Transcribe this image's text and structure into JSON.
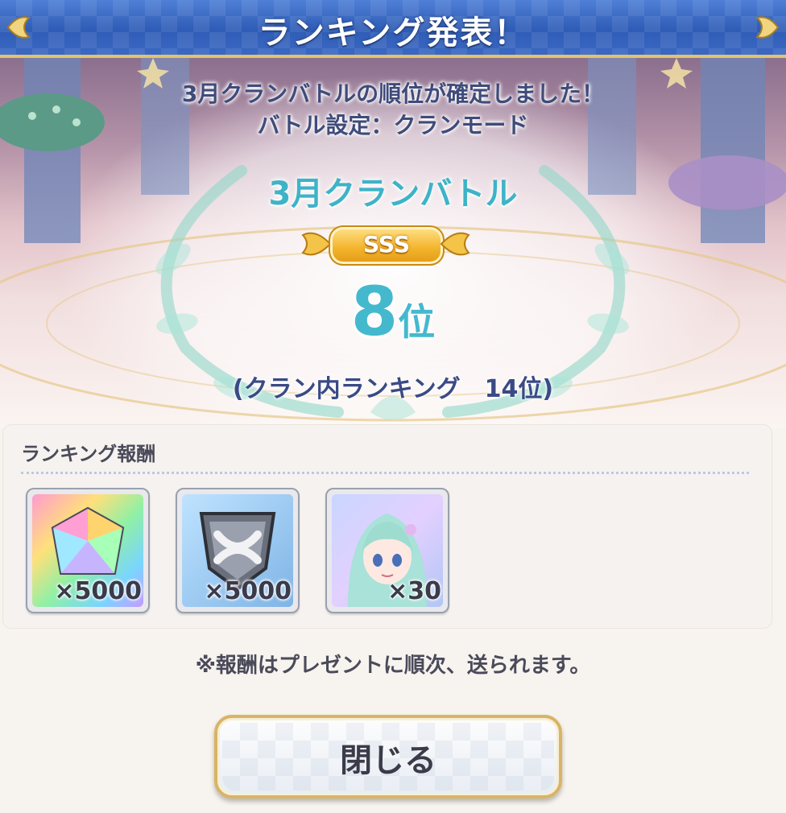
{
  "dialog": {
    "title": "ランキング発表！"
  },
  "result": {
    "message_line1": "3月クランバトルの順位が確定しました！",
    "message_line2": "バトル設定：クランモード",
    "event_name": "3月クランバトル",
    "rank_grade": "SSS",
    "rank_number": "8",
    "rank_suffix": "位",
    "clan_internal_rank": "(クラン内ランキング　14位)"
  },
  "rewards": {
    "heading": "ランキング報酬",
    "items": [
      {
        "icon": "rainbow-gem-icon",
        "quantity": "×5000"
      },
      {
        "icon": "silver-crest-medal-icon",
        "quantity": "×5000"
      },
      {
        "icon": "character-portrait-icon",
        "quantity": "×30"
      }
    ]
  },
  "note": "※報酬はプレゼントに順次、送られます。",
  "close_button": {
    "label": "閉じる"
  },
  "colors": {
    "title_bar": "#2f5cb6",
    "gold_border": "#e2c46a",
    "event_text": "#3eb3c8",
    "rank_badge": "#f2b22a",
    "clan_rank_text": "#3a4a86"
  }
}
